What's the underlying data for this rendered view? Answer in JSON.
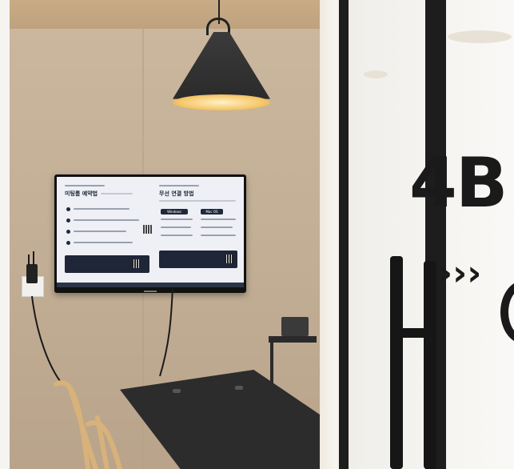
{
  "scene": {
    "description_type": "photo",
    "door_sign": {
      "room_number": "4B",
      "arrow_glyph": "›››"
    },
    "tv_screen": {
      "headline_left": "미팅룸 예약법",
      "headline_right": "무선 연결 방법",
      "tab_windows": "Windows",
      "tab_mac": "Mac OS"
    }
  },
  "colors": {
    "wall": "#c2ae95",
    "lamp": "#2a2a2a",
    "lamp_glow": "#f6c86b",
    "sign": "#1a1a1a",
    "screen_bg": "#eef0f5",
    "screen_dark": "#1e2a3c"
  }
}
